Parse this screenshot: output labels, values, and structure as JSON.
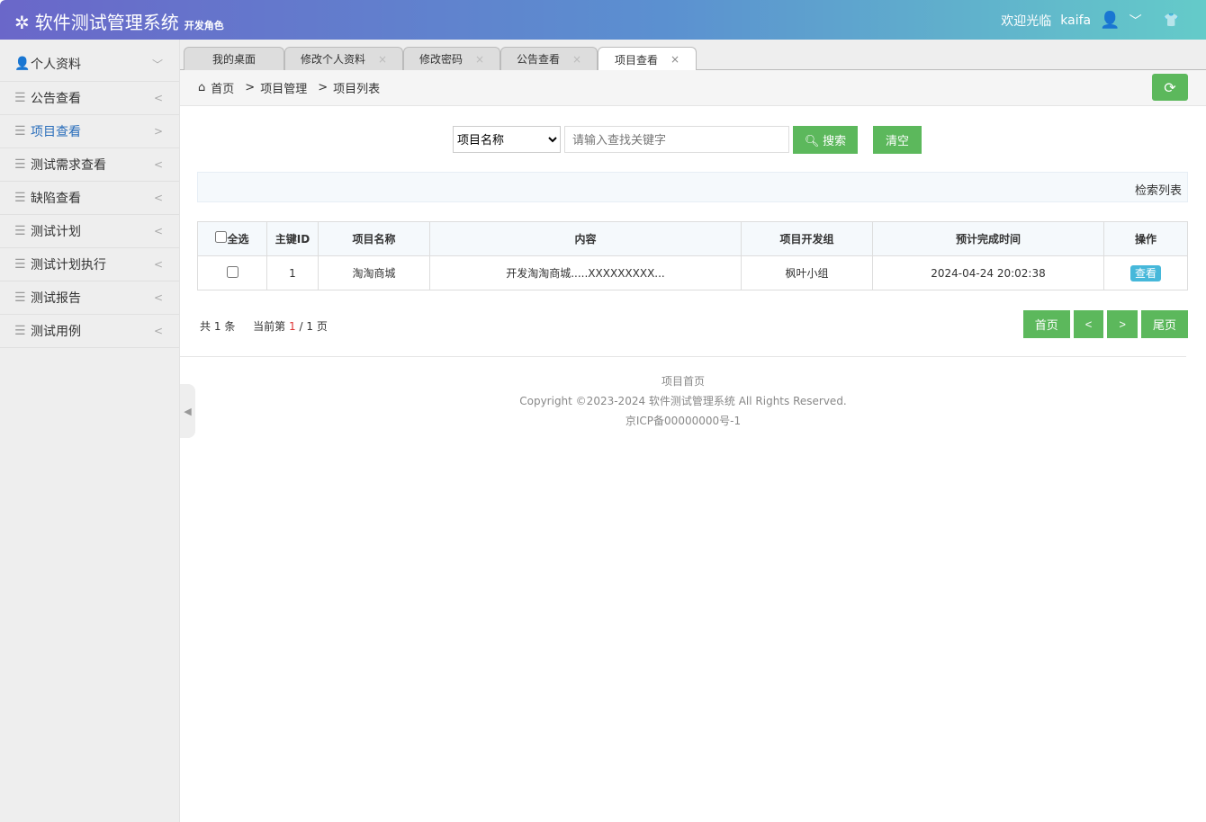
{
  "header": {
    "title": "软件测试管理系统",
    "role": "开发角色",
    "welcome": "欢迎光临",
    "username": "kaifa"
  },
  "sidebar": {
    "items": [
      {
        "label": "个人资料",
        "arrow": "﹀",
        "icon": "user-icon"
      },
      {
        "label": "公告查看",
        "arrow": "<",
        "icon": "menu-icon"
      },
      {
        "label": "项目查看",
        "arrow": ">",
        "icon": "menu-icon"
      },
      {
        "label": "测试需求查看",
        "arrow": "<",
        "icon": "menu-icon"
      },
      {
        "label": "缺陷查看",
        "arrow": "<",
        "icon": "menu-icon"
      },
      {
        "label": "测试计划",
        "arrow": "<",
        "icon": "menu-icon"
      },
      {
        "label": "测试计划执行",
        "arrow": "<",
        "icon": "menu-icon"
      },
      {
        "label": "测试报告",
        "arrow": "<",
        "icon": "menu-icon"
      },
      {
        "label": "测试用例",
        "arrow": "<",
        "icon": "menu-icon"
      }
    ]
  },
  "tabs": [
    {
      "label": "我的桌面"
    },
    {
      "label": "修改个人资料"
    },
    {
      "label": "修改密码"
    },
    {
      "label": "公告查看"
    },
    {
      "label": "项目查看"
    }
  ],
  "breadcrumb": {
    "home": "首页",
    "sep": ">",
    "level1": "项目管理",
    "level2": "项目列表"
  },
  "search": {
    "field": "项目名称",
    "placeholder": "请输入查找关键字",
    "search_label": "搜索",
    "clear_label": "清空"
  },
  "list_title": "检索列表",
  "table": {
    "select_all": "全选",
    "headers": [
      "主键ID",
      "项目名称",
      "内容",
      "项目开发组",
      "预计完成时间",
      "操作"
    ],
    "rows": [
      {
        "id": "1",
        "name": "淘淘商城",
        "content": "开发淘淘商城.....XXXXXXXXX...",
        "group": "枫叶小组",
        "time": "2024-04-24 20:02:38",
        "action": "查看"
      }
    ]
  },
  "pagination": {
    "total_prefix": "共",
    "total": "1",
    "total_suffix": "条",
    "current_prefix": "当前第",
    "current": "1",
    "sep": "/",
    "pages": "1",
    "pages_suffix": "页",
    "first": "首页",
    "prev": "<",
    "next": ">",
    "last": "尾页"
  },
  "footer": {
    "line1": "项目首页",
    "line2": "Copyright ©2023-2024 软件测试管理系统 All Rights Reserved.",
    "line3": "京ICP备00000000号-1"
  }
}
